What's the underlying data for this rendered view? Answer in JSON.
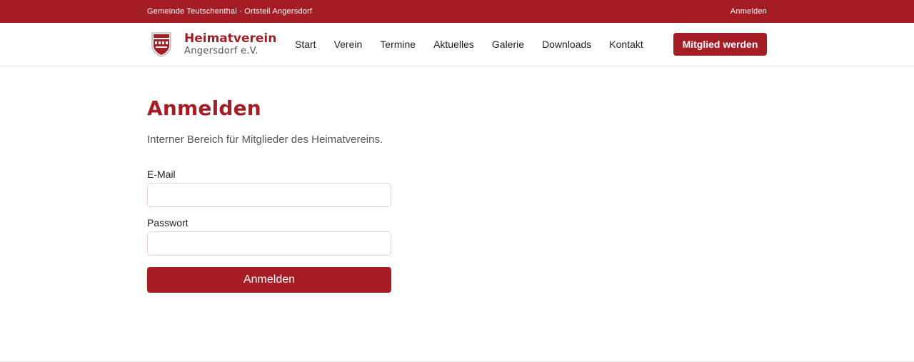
{
  "topbar": {
    "location": "Gemeinde Teutschenthal · Ortsteil Angersdorf",
    "login_link": "Anmelden"
  },
  "brand": {
    "title": "Heimatverein",
    "subtitle": "Angersdorf e.V.",
    "logo_icon": "crest-shield-icon"
  },
  "nav": {
    "items": [
      {
        "label": "Start"
      },
      {
        "label": "Verein"
      },
      {
        "label": "Termine"
      },
      {
        "label": "Aktuelles"
      },
      {
        "label": "Galerie"
      },
      {
        "label": "Downloads"
      },
      {
        "label": "Kontakt"
      }
    ],
    "cta_label": "Mitglied werden"
  },
  "main": {
    "title": "Anmelden",
    "lead": "Interner Bereich für Mitglieder des Heimatvereins."
  },
  "form": {
    "email_label": "E-Mail",
    "email_value": "",
    "email_placeholder": "",
    "password_label": "Passwort",
    "password_value": "",
    "password_placeholder": "",
    "submit_label": "Anmelden"
  },
  "colors": {
    "accent": "#a51d24",
    "input_border": "#efd1cc",
    "text": "#1f1f1f",
    "muted": "#555555"
  }
}
